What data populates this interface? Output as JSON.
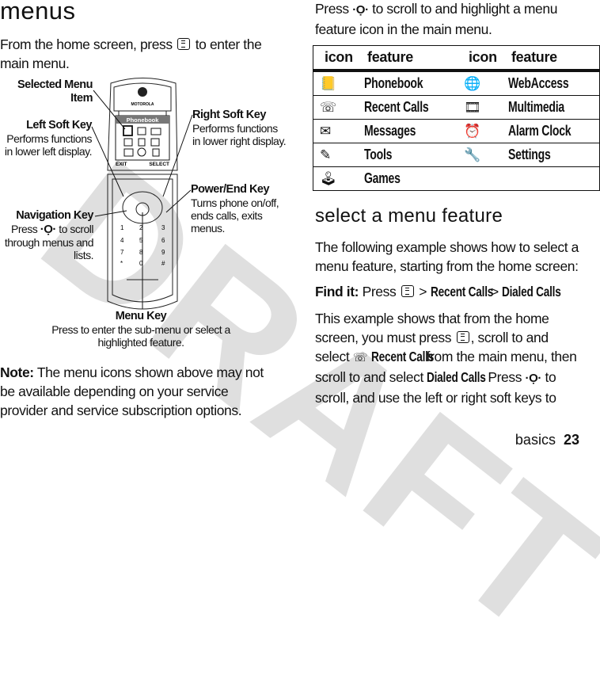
{
  "watermark": "DRAFT",
  "left": {
    "title": "menus",
    "intro_1": "From the home screen, press",
    "intro_2": "to enter the",
    "intro_3": "main menu.",
    "diagram": {
      "screen_title": "Phonebook",
      "brand": "MOTOROLA",
      "soft_left": "EXIT",
      "soft_right": "SELECT",
      "selected_item": {
        "title_1": "Selected Menu",
        "title_2": "Item"
      },
      "left_soft_key": {
        "title": "Left Soft Key",
        "desc_1": "Performs functions",
        "desc_2": "in lower left display."
      },
      "right_soft_key": {
        "title": "Right Soft Key",
        "desc_1": "Performs functions",
        "desc_2": "in lower right display."
      },
      "power_key": {
        "title": "Power/End Key",
        "desc_1": "Turns phone on/off,",
        "desc_2": "ends calls, exits",
        "desc_3": "menus."
      },
      "nav_key": {
        "title": "Navigation Key",
        "desc_1a": "Press",
        "desc_1b": "to scroll",
        "desc_2": "through menus and",
        "desc_3": "lists."
      },
      "menu_key": {
        "title": "Menu Key",
        "desc_1": "Press to enter the sub-menu or select a",
        "desc_2": "highlighted feature."
      },
      "keypad": [
        "1",
        "2",
        "3",
        "4",
        "5",
        "6",
        "7",
        "8",
        "9",
        "*",
        "0",
        "#"
      ]
    },
    "note_label": "Note:",
    "note_1": "The menu icons shown above may not",
    "note_2": "be available depending on your service",
    "note_3": "provider and service subscription options."
  },
  "right": {
    "intro_1a": "Press",
    "intro_1b": "to scroll to and highlight a menu",
    "intro_2": "feature icon in the main menu.",
    "table": {
      "headers": [
        "icon",
        "feature",
        "icon",
        "feature"
      ],
      "rows": [
        [
          {
            "icon": "phonebook-icon",
            "feature": "Phonebook"
          },
          {
            "icon": "webaccess-icon",
            "feature": "WebAccess"
          }
        ],
        [
          {
            "icon": "recent-calls-icon",
            "feature": "Recent Calls"
          },
          {
            "icon": "multimedia-icon",
            "feature": "Multimedia"
          }
        ],
        [
          {
            "icon": "messages-icon",
            "feature": "Messages"
          },
          {
            "icon": "alarm-clock-icon",
            "feature": "Alarm Clock"
          }
        ],
        [
          {
            "icon": "tools-icon",
            "feature": "Tools"
          },
          {
            "icon": "settings-icon",
            "feature": "Settings"
          }
        ],
        [
          {
            "icon": "games-icon",
            "feature": "Games"
          },
          {
            "icon": "",
            "feature": ""
          }
        ]
      ]
    },
    "section_title": "select a menu feature",
    "p1_1": "The following example shows how to select a",
    "p1_2": "menu feature, starting from the home screen:",
    "find_label": "Find it:",
    "find_press": "Press",
    "find_sep": ">",
    "find_item1": "Recent Calls",
    "find_item2": "Dialed Calls",
    "p2_1": "This example shows that from the home",
    "p2_2a": "screen, you must press",
    "p2_2b": ", scroll to and",
    "p2_3a": "select",
    "p2_3b": "Recent Calls",
    "p2_3c": "from the main menu, then",
    "p2_4a": "scroll to and select",
    "p2_4b": "Dialed Calls",
    "p2_4c": ". Press",
    "p2_4d": "to",
    "p2_5": "scroll, and use the left or right soft keys to"
  },
  "footer": {
    "section": "basics",
    "page": "23"
  }
}
